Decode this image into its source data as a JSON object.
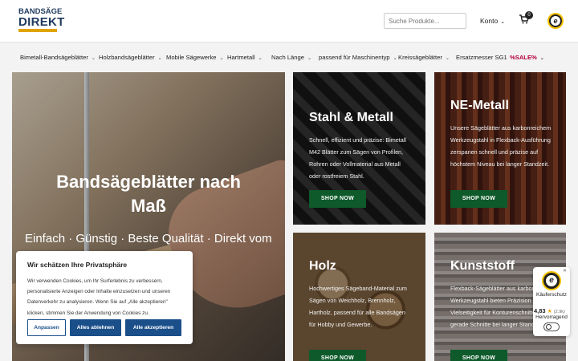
{
  "header": {
    "logo_line1": "BANDSÄGE",
    "logo_line2": "DIREKT",
    "search_placeholder": "Suche Produkte...",
    "account_label": "Konto",
    "cart_count": "0"
  },
  "nav": {
    "items": [
      {
        "label": "Bimetall-Bandsägeblätter",
        "dropdown": true
      },
      {
        "label": "Holzbandsägeblätter",
        "dropdown": true
      },
      {
        "label": "Mobile Sägewerke",
        "dropdown": true
      },
      {
        "label": "Hartmetall",
        "dropdown": true
      },
      {
        "label": "Nach Länge",
        "dropdown": true
      },
      {
        "label": "passend für Maschinentyp",
        "dropdown": true
      },
      {
        "label": "Kreissägeblätter",
        "dropdown": true
      },
      {
        "label": "Ersatzmesser SG1",
        "dropdown": false
      },
      {
        "label": "%SALE%",
        "dropdown": true
      }
    ]
  },
  "hero": {
    "title_line1": "Bandsägeblätter nach",
    "title_line2": "Maß",
    "tagline": "Einfach · Günstig · Beste Qualität · Direkt vom"
  },
  "tiles": [
    {
      "title": "Stahl & Metall",
      "text": "Schnell, effizient und präzise: Bimetall M42 Blätter zum Sägen von Profilen, Rohren oder Vollmaterial aus Metall oder rostfreiem Stahl.",
      "button": "SHOP NOW"
    },
    {
      "title": "NE-Metall",
      "text": "Unsere Sägeblätter aus karbonreichem Werkzeugstahl in Flexback-Ausführung zerspanen schnell und präzise auf höchstem Niveau bei langer Standzeit.",
      "button": "SHOP NOW"
    },
    {
      "title": "Holz",
      "text": "Hochwertiges Sägeband-Material zum Sägen von Weichholz, Brennholz, Hartholz, passend für alle Bandsägen für Hobby und Gewerbe.",
      "button": "SHOP NOW"
    },
    {
      "title": "Kunststoff",
      "text": "Flexback-Sägeblätter aus karbonreichem Werkzeugstahl bieten Präzision und Vielseitigkeit für Konturenschnitte und gerade Schnitte bei langer Standzeit.",
      "button": "SHOP NOW"
    }
  ],
  "cookie": {
    "title": "Wir schätzen Ihre Privatsphäre",
    "text": "Wir verwenden Cookies, um Ihr Surferlebnis zu verbessern, personalisierte Anzeigen oder Inhalte einzusetzen und unseren Datenverkehr zu analysieren. Wenn Sie auf „Alle akzeptieren\" klicken, stimmen Sie der Anwendung von Cookies zu.",
    "btn_customize": "Anpassen",
    "btn_reject": "Alles ablehnen",
    "btn_accept": "Alle akzeptieren"
  },
  "trusted": {
    "label": "Käuferschutz",
    "rating": "4,83",
    "count": "(2.9k)",
    "verdict": "Hervorragend"
  },
  "colors": {
    "brand_blue": "#1f3a5f",
    "brand_yellow": "#e0a300",
    "shop_button": "#0e5a2b",
    "cookie_button": "#1b4f8a",
    "sale": "#b3003c"
  }
}
